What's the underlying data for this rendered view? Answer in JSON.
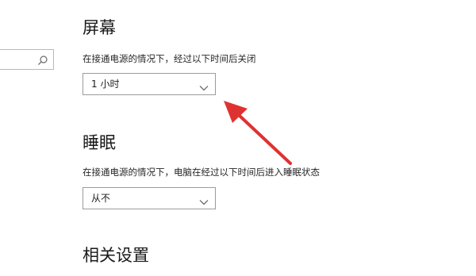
{
  "search": {
    "placeholder": "",
    "icon": "search-icon"
  },
  "screen": {
    "title": "屏幕",
    "description": "在接通电源的情况下，经过以下时间后关闭",
    "dropdown_value": "1 小时"
  },
  "sleep": {
    "title": "睡眠",
    "description": "在接通电源的情况下，电脑在经过以下时间后进入睡眠状态",
    "dropdown_value": "从不"
  },
  "related": {
    "title": "相关设置"
  },
  "annotation": {
    "arrow_color": "#e03131"
  },
  "colors": {
    "dropdown_border": "#9b9b9b",
    "text": "#1f1f1f"
  }
}
